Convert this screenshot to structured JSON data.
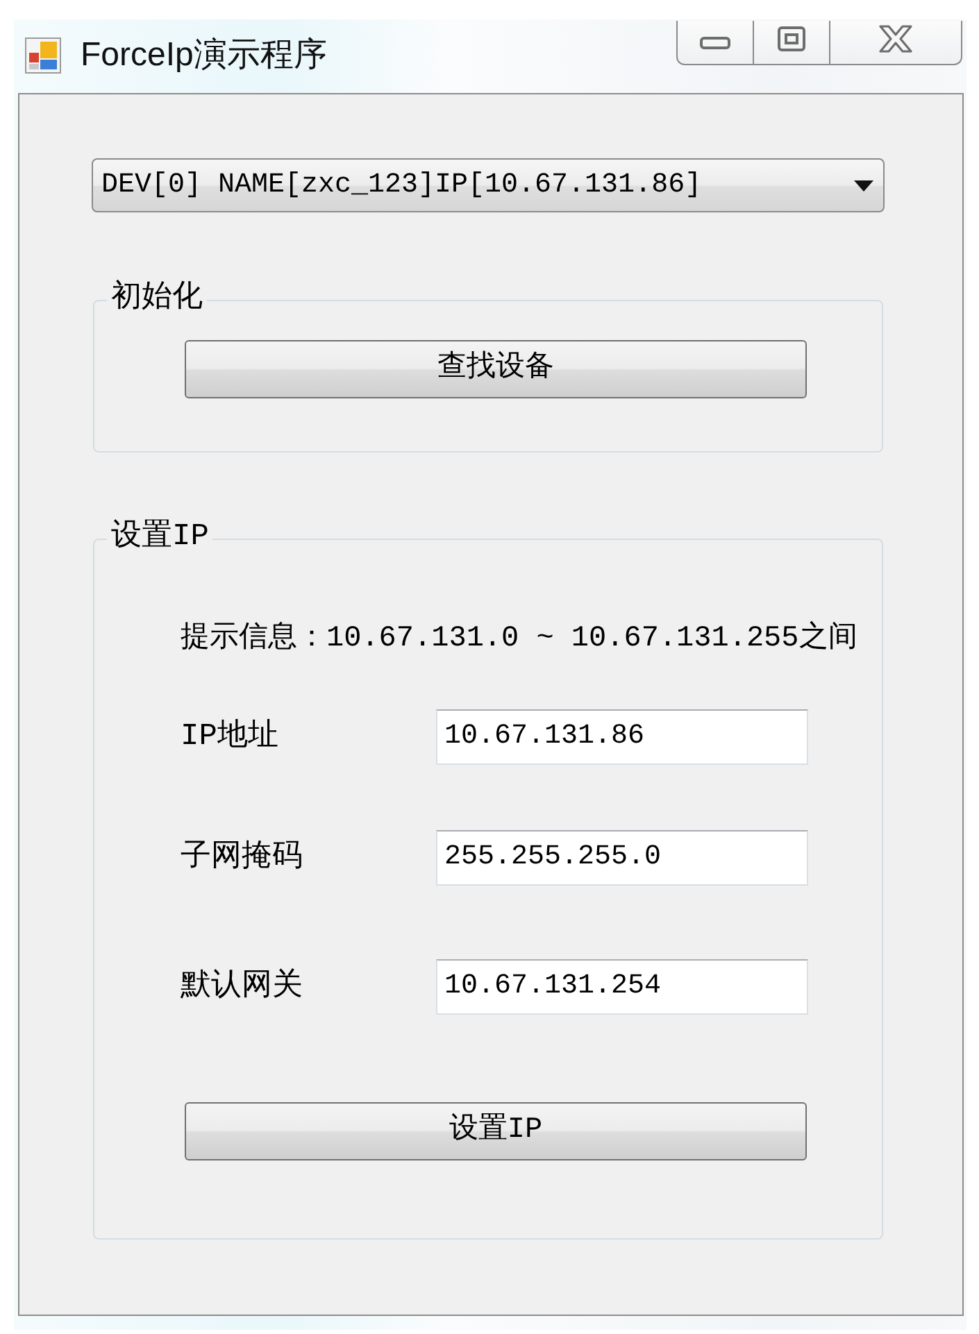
{
  "window": {
    "title": "ForceIp演示程序"
  },
  "device_select": {
    "value": "DEV[0] NAME[zxc_123]IP[10.67.131.86]"
  },
  "init_group": {
    "label": "初始化",
    "button": "查找设备"
  },
  "ip_group": {
    "label": "设置IP",
    "hint": "提示信息：10.67.131.0 ~ 10.67.131.255之间",
    "fields": [
      {
        "label": "IP地址",
        "value": "10.67.131.86"
      },
      {
        "label": "子网掩码",
        "value": "255.255.255.0"
      },
      {
        "label": "默认网关",
        "value": "10.67.131.254"
      }
    ],
    "button": "设置IP"
  }
}
